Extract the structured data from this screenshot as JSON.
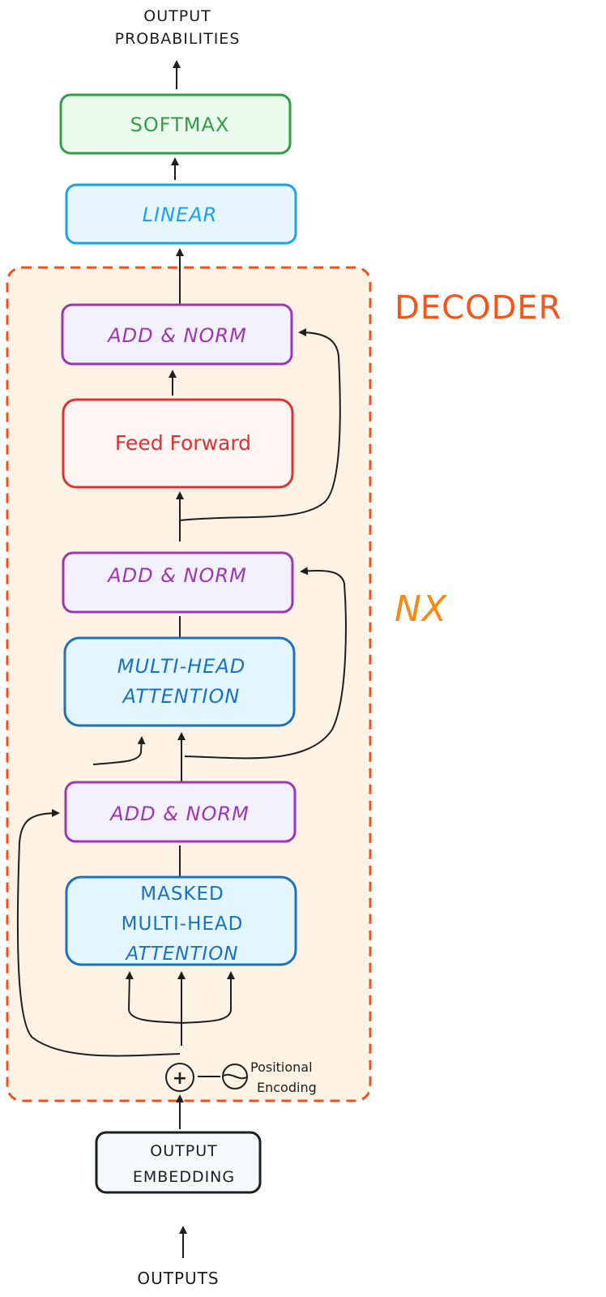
{
  "title_top": {
    "line1": "OUTPUT",
    "line2": "PROBABILITIES"
  },
  "decoder_label": "DECODER",
  "repeat_label": "NX",
  "blocks": {
    "softmax": {
      "label": "SOFTMAX",
      "stroke": "#2f9e44",
      "fill": "#ebfbee",
      "text": "#2f9e44"
    },
    "linear": {
      "label": "LINEAR",
      "stroke": "#1ba1f2",
      "fill": "#e7f5ff",
      "text": "#1ba1f2"
    },
    "add_norm_top": {
      "label": "ADD & NORM",
      "stroke": "#9c36b5",
      "fill": "#f3f0ff",
      "text": "#9c36b5"
    },
    "feed_forward": {
      "label": "Feed Forward",
      "stroke": "#e03131",
      "fill": "#fff5f5",
      "text": "#e03131"
    },
    "add_norm_mid": {
      "label": "ADD & NORM",
      "stroke": "#9c36b5",
      "fill": "#f3f0ff",
      "text": "#9c36b5"
    },
    "mha": {
      "line1": "MULTI-HEAD",
      "line2": "ATTENTION",
      "stroke": "#1971c2",
      "fill": "#e3f6ff",
      "text": "#1971c2"
    },
    "add_norm_bottom": {
      "label": "ADD & NORM",
      "stroke": "#9c36b5",
      "fill": "#f3f0ff",
      "text": "#9c36b5"
    },
    "masked_mha": {
      "line1": "MASKED",
      "line2": "MULTI-HEAD",
      "line3": "ATTENTION",
      "stroke": "#1971c2",
      "fill": "#e3f6ff",
      "text": "#1971c2"
    },
    "output_embedding": {
      "line1": "OUTPUT",
      "line2": "EMBEDDING",
      "stroke": "#1e1e1e",
      "fill": "#f8f9fa",
      "text": "#1e1e1e"
    }
  },
  "positional": {
    "symbol": "+",
    "line1": "Positional",
    "line2": "Encoding"
  },
  "bottom_label": "OUTPUTS",
  "colors": {
    "decoder_border": "#f0521a",
    "decoder_fill": "#fdf2e3",
    "decoder_text": "#f75417",
    "repeat_text": "#f88a14",
    "arrow": "#1e1e1e"
  }
}
